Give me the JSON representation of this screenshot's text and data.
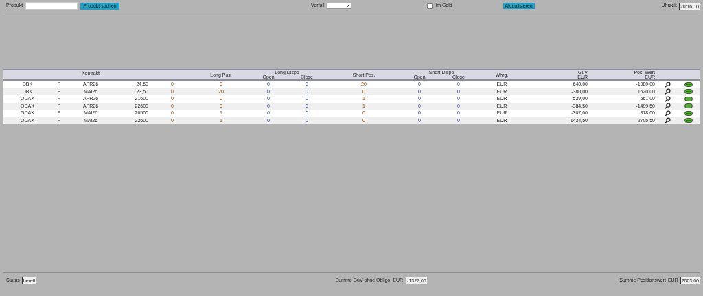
{
  "toolbar": {
    "product_label": "Produkt",
    "search_button": "Produkt suchen",
    "expiry_label": "Verfall",
    "in_money": {
      "label": "im Geld",
      "checked": false
    },
    "refresh_button": "Aktualisieren",
    "time_label": "Uhrzeit",
    "time_value": "20:16:10"
  },
  "table": {
    "headers": {
      "contract": "Kontrakt",
      "long_pos": "Long Pos.",
      "long_dispo": "Long Dispo",
      "long_open": "Open",
      "long_close": "Close",
      "short_pos": "Short Pos.",
      "short_dispo": "Short Dispo",
      "short_open": "Open",
      "short_close": "Close",
      "currency": "Whrg.",
      "guv": [
        "GuV",
        "EUR"
      ],
      "pos_value": [
        "Pos. Wert",
        "EUR"
      ]
    },
    "rows": [
      {
        "cells": [
          "DBK",
          "P",
          "APR26",
          "24,50",
          "0",
          "0",
          "0",
          "0",
          "20",
          "0",
          "0",
          "EUR",
          "640,00",
          "-1080,00"
        ]
      },
      {
        "cells": [
          "DBK",
          "P",
          "MAI26",
          "23,50",
          "0",
          "20",
          "0",
          "0",
          "0",
          "0",
          "0",
          "EUR",
          "-380,00",
          "1620,00"
        ]
      },
      {
        "cells": [
          "ODAX",
          "P",
          "APR26",
          "21600",
          "0",
          "0",
          "0",
          "0",
          "1",
          "0",
          "0",
          "EUR",
          "539,00",
          "-561,00"
        ]
      },
      {
        "cells": [
          "ODAX",
          "P",
          "APR26",
          "22600",
          "0",
          "0",
          "0",
          "0",
          "1",
          "0",
          "0",
          "EUR",
          "-384,50",
          "-1499,50"
        ]
      },
      {
        "cells": [
          "ODAX",
          "P",
          "MAI26",
          "20500",
          "0",
          "1",
          "0",
          "0",
          "0",
          "0",
          "0",
          "EUR",
          "-307,00",
          "818,00"
        ]
      },
      {
        "cells": [
          "ODAX",
          "P",
          "MAI26",
          "22600",
          "0",
          "1",
          "0",
          "0",
          "0",
          "0",
          "0",
          "EUR",
          "-1434,50",
          "2705,50"
        ]
      }
    ]
  },
  "status_bar": {
    "status_label": "Status",
    "status_value": "bereit",
    "guv_label": "Summe GuV ohne Obligo",
    "guv_currency": "EUR",
    "guv_value": "-1327,00",
    "pos_label": "Summe Positionswert",
    "pos_currency": "EUR",
    "pos_value": "2003,00"
  }
}
